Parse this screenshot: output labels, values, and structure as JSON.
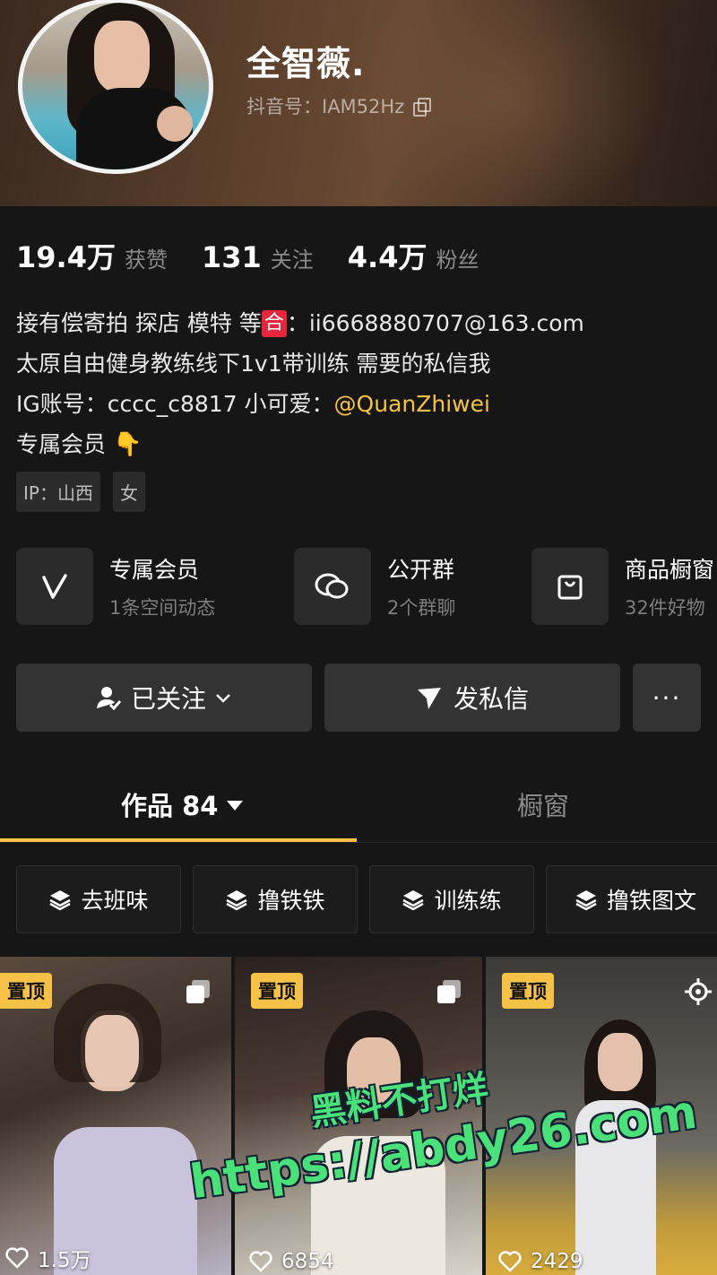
{
  "profile": {
    "name": "全智薇.",
    "douyin_id": "抖音号：IAM52Hz"
  },
  "stats": [
    {
      "num": "19.4万",
      "label": "获赞"
    },
    {
      "num": "131",
      "label": "关注"
    },
    {
      "num": "4.4万",
      "label": "粉丝"
    }
  ],
  "bio": {
    "line1_a": "接有偿寄拍 探店 模特 等",
    "line1_he": "合",
    "line1_b": "：ii6668880707@163.com",
    "line2": "太原自由健身教练线下1v1带训练 需要的私信我",
    "line3_a": "IG账号：cccc_c8817 小可爱：",
    "line3_link": "@QuanZhiwei",
    "line4": "专属会员",
    "line4_emoji": "👇"
  },
  "tags": [
    "IP：山西",
    "女"
  ],
  "features": [
    {
      "title": "专属会员",
      "sub": "1条空间动态",
      "icon": "v-icon"
    },
    {
      "title": "公开群",
      "sub": "2个群聊",
      "icon": "chat-bubbles-icon"
    },
    {
      "title": "商品橱窗",
      "sub": "32件好物",
      "icon": "shopping-bag-icon"
    }
  ],
  "actions": {
    "follow": "已关注",
    "message": "发私信",
    "more": "···"
  },
  "tabs": {
    "works": "作品 84",
    "window": "橱窗"
  },
  "collections": [
    "去班味",
    "撸铁铁",
    "训练练",
    "撸铁图文"
  ],
  "videos": [
    {
      "pin": "置顶",
      "likes": "1.5万",
      "multi": true
    },
    {
      "pin": "置顶",
      "likes": "6854",
      "multi": true
    },
    {
      "pin": "置顶",
      "likes": "2429",
      "multi": false
    }
  ],
  "watermark": {
    "line1": "黑料不打烊",
    "line2": "https://abdy26.com"
  },
  "colors": {
    "accent": "#f5c247",
    "background": "#161616",
    "button": "#333333",
    "watermark": "#4be17a"
  }
}
